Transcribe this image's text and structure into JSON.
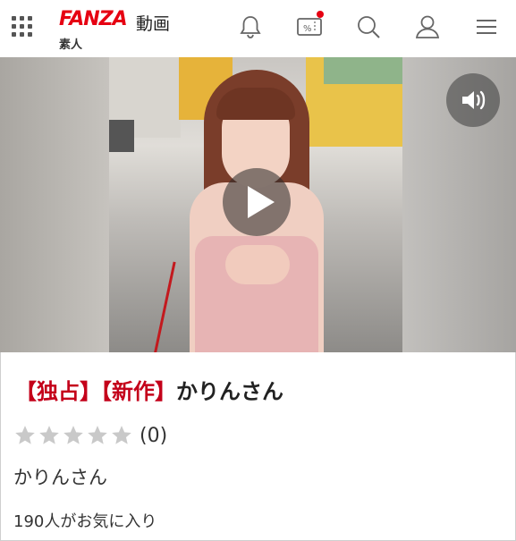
{
  "header": {
    "logo_text": "FANZA",
    "service_label": "動画",
    "section_label": "素人",
    "icons": [
      "grid-menu-icon",
      "bell-icon",
      "sale-tag-icon",
      "search-icon",
      "user-icon",
      "hamburger-menu-icon"
    ],
    "notification_dot_color": "#e60012",
    "brand_color": "#e60012"
  },
  "media": {
    "play_icon": "play-icon",
    "sound_icon": "speaker-icon"
  },
  "product": {
    "tag_exclusive": "【独占】",
    "tag_new": "【新作】",
    "title": "かりんさん",
    "tag_color": "#c4001a",
    "rating_stars": 0,
    "rating_max": 5,
    "rating_count": "(0)",
    "performer": "かりんさん",
    "favorites": "190人がお気に入り"
  }
}
